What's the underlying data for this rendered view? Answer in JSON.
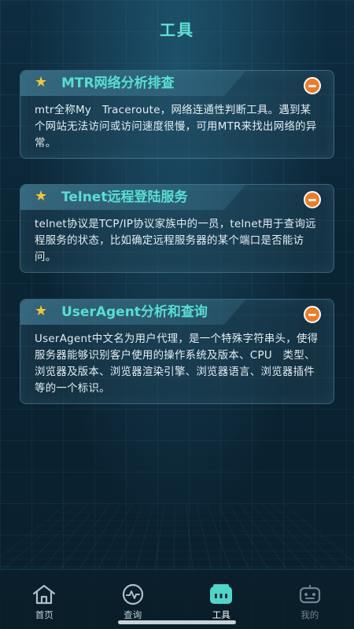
{
  "header": {
    "title": "工具"
  },
  "cards": [
    {
      "title": "MTR网络分析排查",
      "description": "mtr全称My　Traceroute，网络连通性判断工具。遇到某个网站无法访问或访问速度很慢，可用MTR来找出网络的异常。"
    },
    {
      "title": "Telnet远程登陆服务",
      "description": "telnet协议是TCP/IP协议家族中的一员，telnet用于查询远程服务的状态，比如确定远程服务器的某个端口是否能访问。"
    },
    {
      "title": "UserAgent分析和查询",
      "description": "UserAgent中文名为用户代理，是一个特殊字符串头，使得服务器能够识别客户使用的操作系统及版本、CPU　类型、浏览器及版本、浏览器渲染引擎、浏览器语言、浏览器插件等的一个标识。"
    }
  ],
  "icons": {
    "card_marker": "star-icon",
    "card_action": "collapse-icon"
  },
  "colors": {
    "accent": "#57dfd2",
    "star": "#f7c531",
    "action": "#f07b25"
  },
  "tabbar": {
    "items": [
      {
        "label": "首页",
        "icon": "home-icon",
        "active": false
      },
      {
        "label": "查询",
        "icon": "activity-icon",
        "active": false
      },
      {
        "label": "工具",
        "icon": "toolbox-icon",
        "active": true
      },
      {
        "label": "我的",
        "icon": "robot-icon",
        "active": false
      }
    ]
  }
}
